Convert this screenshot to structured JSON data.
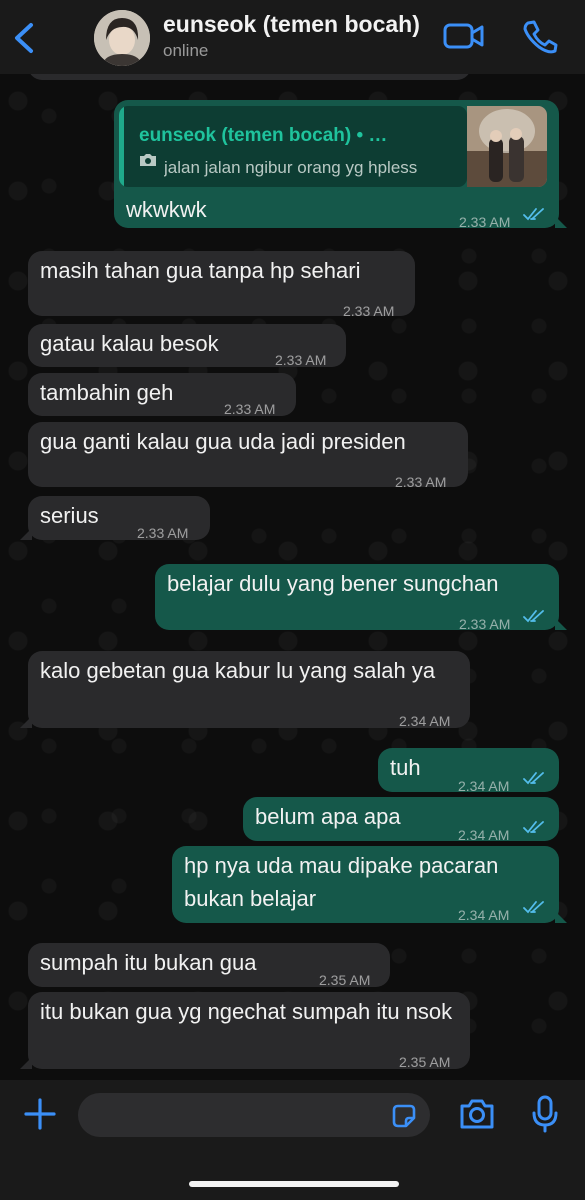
{
  "colors": {
    "accent": "#3b8ff7",
    "outgoing_bubble": "#15584a",
    "incoming_bubble": "#2a2a2c",
    "read_tick": "#53bdeb",
    "quote_name": "#1fc39d"
  },
  "header": {
    "contact_name": "eunseok (temen bocah)",
    "status": "online"
  },
  "reply": {
    "quoted_name": "eunseok (temen bocah) • Status",
    "quoted_text": "jalan jalan ngibur orang yg hpless"
  },
  "messages": [
    {
      "dir": "out",
      "text": "wkwkwk",
      "time": "2.33 AM",
      "read": true
    },
    {
      "dir": "in",
      "text": "masih tahan gua tanpa hp sehari",
      "time": "2.33 AM"
    },
    {
      "dir": "in",
      "text": "gatau kalau besok",
      "time": "2.33 AM"
    },
    {
      "dir": "in",
      "text": "tambahin geh",
      "time": "2.33 AM"
    },
    {
      "dir": "in",
      "text": "gua ganti kalau gua uda jadi presiden",
      "time": "2.33 AM"
    },
    {
      "dir": "in",
      "text": "serius",
      "time": "2.33 AM"
    },
    {
      "dir": "out",
      "text": "belajar dulu yang bener sungchan",
      "time": "2.33 AM",
      "read": true
    },
    {
      "dir": "in",
      "text": "kalo gebetan gua kabur lu yang salah ya",
      "time": "2.34 AM"
    },
    {
      "dir": "out",
      "text": "tuh",
      "time": "2.34 AM",
      "read": true
    },
    {
      "dir": "out",
      "text": "belum apa apa",
      "time": "2.34 AM",
      "read": true
    },
    {
      "dir": "out",
      "text": "hp nya uda mau dipake pacaran bukan belajar",
      "time": "2.34 AM",
      "read": true
    },
    {
      "dir": "in",
      "text": "sumpah itu bukan gua",
      "time": "2.35 AM"
    },
    {
      "dir": "in",
      "text": "itu bukan gua yg ngechat sumpah itu nsok",
      "time": "2.35 AM"
    }
  ],
  "icons": {
    "back": "chevron-left-icon",
    "video": "video-call-icon",
    "call": "phone-icon",
    "attach": "plus-icon",
    "sticker": "sticker-icon",
    "camera": "camera-icon",
    "mic": "microphone-icon"
  }
}
